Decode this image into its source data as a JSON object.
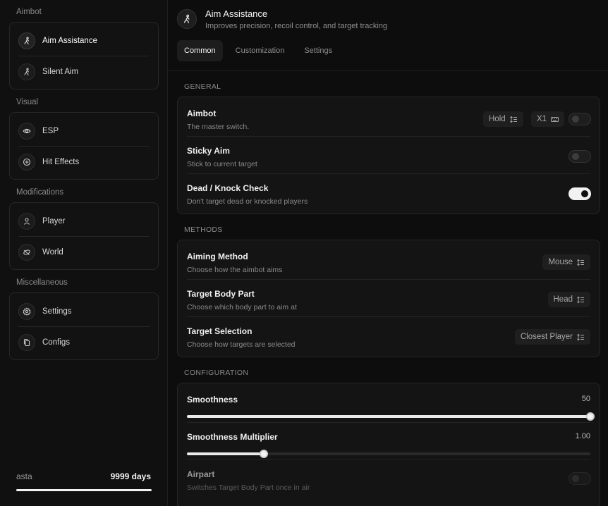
{
  "sidebar": {
    "sections": [
      {
        "title": "Aimbot",
        "items": [
          {
            "label": "Aim Assistance",
            "icon": "aim-icon",
            "active": true
          },
          {
            "label": "Silent Aim",
            "icon": "silent-aim-icon"
          }
        ]
      },
      {
        "title": "Visual",
        "items": [
          {
            "label": "ESP",
            "icon": "eye-icon"
          },
          {
            "label": "Hit Effects",
            "icon": "target-icon"
          }
        ]
      },
      {
        "title": "Modifications",
        "items": [
          {
            "label": "Player",
            "icon": "user-icon"
          },
          {
            "label": "World",
            "icon": "world-icon"
          }
        ]
      },
      {
        "title": "Miscellaneous",
        "items": [
          {
            "label": "Settings",
            "icon": "gear-icon"
          },
          {
            "label": "Configs",
            "icon": "copy-icon"
          }
        ]
      }
    ],
    "footer": {
      "user": "asta",
      "days": "9999 days",
      "progress": 1.0
    }
  },
  "header": {
    "title": "Aim Assistance",
    "subtitle": "Improves precision, recoil control, and target tracking",
    "tabs": [
      {
        "label": "Common",
        "active": true
      },
      {
        "label": "Customization"
      },
      {
        "label": "Settings"
      }
    ]
  },
  "general": {
    "title": "GENERAL",
    "aimbot": {
      "title": "Aimbot",
      "desc": "The master switch.",
      "mode": "Hold",
      "key": "X1",
      "enabled": false
    },
    "sticky": {
      "title": "Sticky Aim",
      "desc": "Stick to current target",
      "enabled": false
    },
    "dead": {
      "title": "Dead / Knock Check",
      "desc": "Don't target dead or knocked players",
      "enabled": true
    }
  },
  "methods": {
    "title": "METHODS",
    "aiming": {
      "title": "Aiming Method",
      "desc": "Choose how the aimbot aims",
      "value": "Mouse"
    },
    "bodypart": {
      "title": "Target Body Part",
      "desc": "Choose which body part to aim at",
      "value": "Head"
    },
    "selection": {
      "title": "Target Selection",
      "desc": "Choose how targets are selected",
      "value": "Closest Player"
    }
  },
  "configuration": {
    "title": "CONFIGURATION",
    "smoothness": {
      "title": "Smoothness",
      "value": "50",
      "fraction": 1.0
    },
    "multiplier": {
      "title": "Smoothness Multiplier",
      "value": "1.00",
      "fraction": 0.19
    },
    "airpart": {
      "title": "Airpart",
      "desc": "Switches Target Body Part once in air",
      "enabled": false
    }
  },
  "colors": {
    "background": "#0c0c0c",
    "card": "#141414",
    "accent": "#f2f2f2",
    "muted": "#8a8a8a"
  }
}
